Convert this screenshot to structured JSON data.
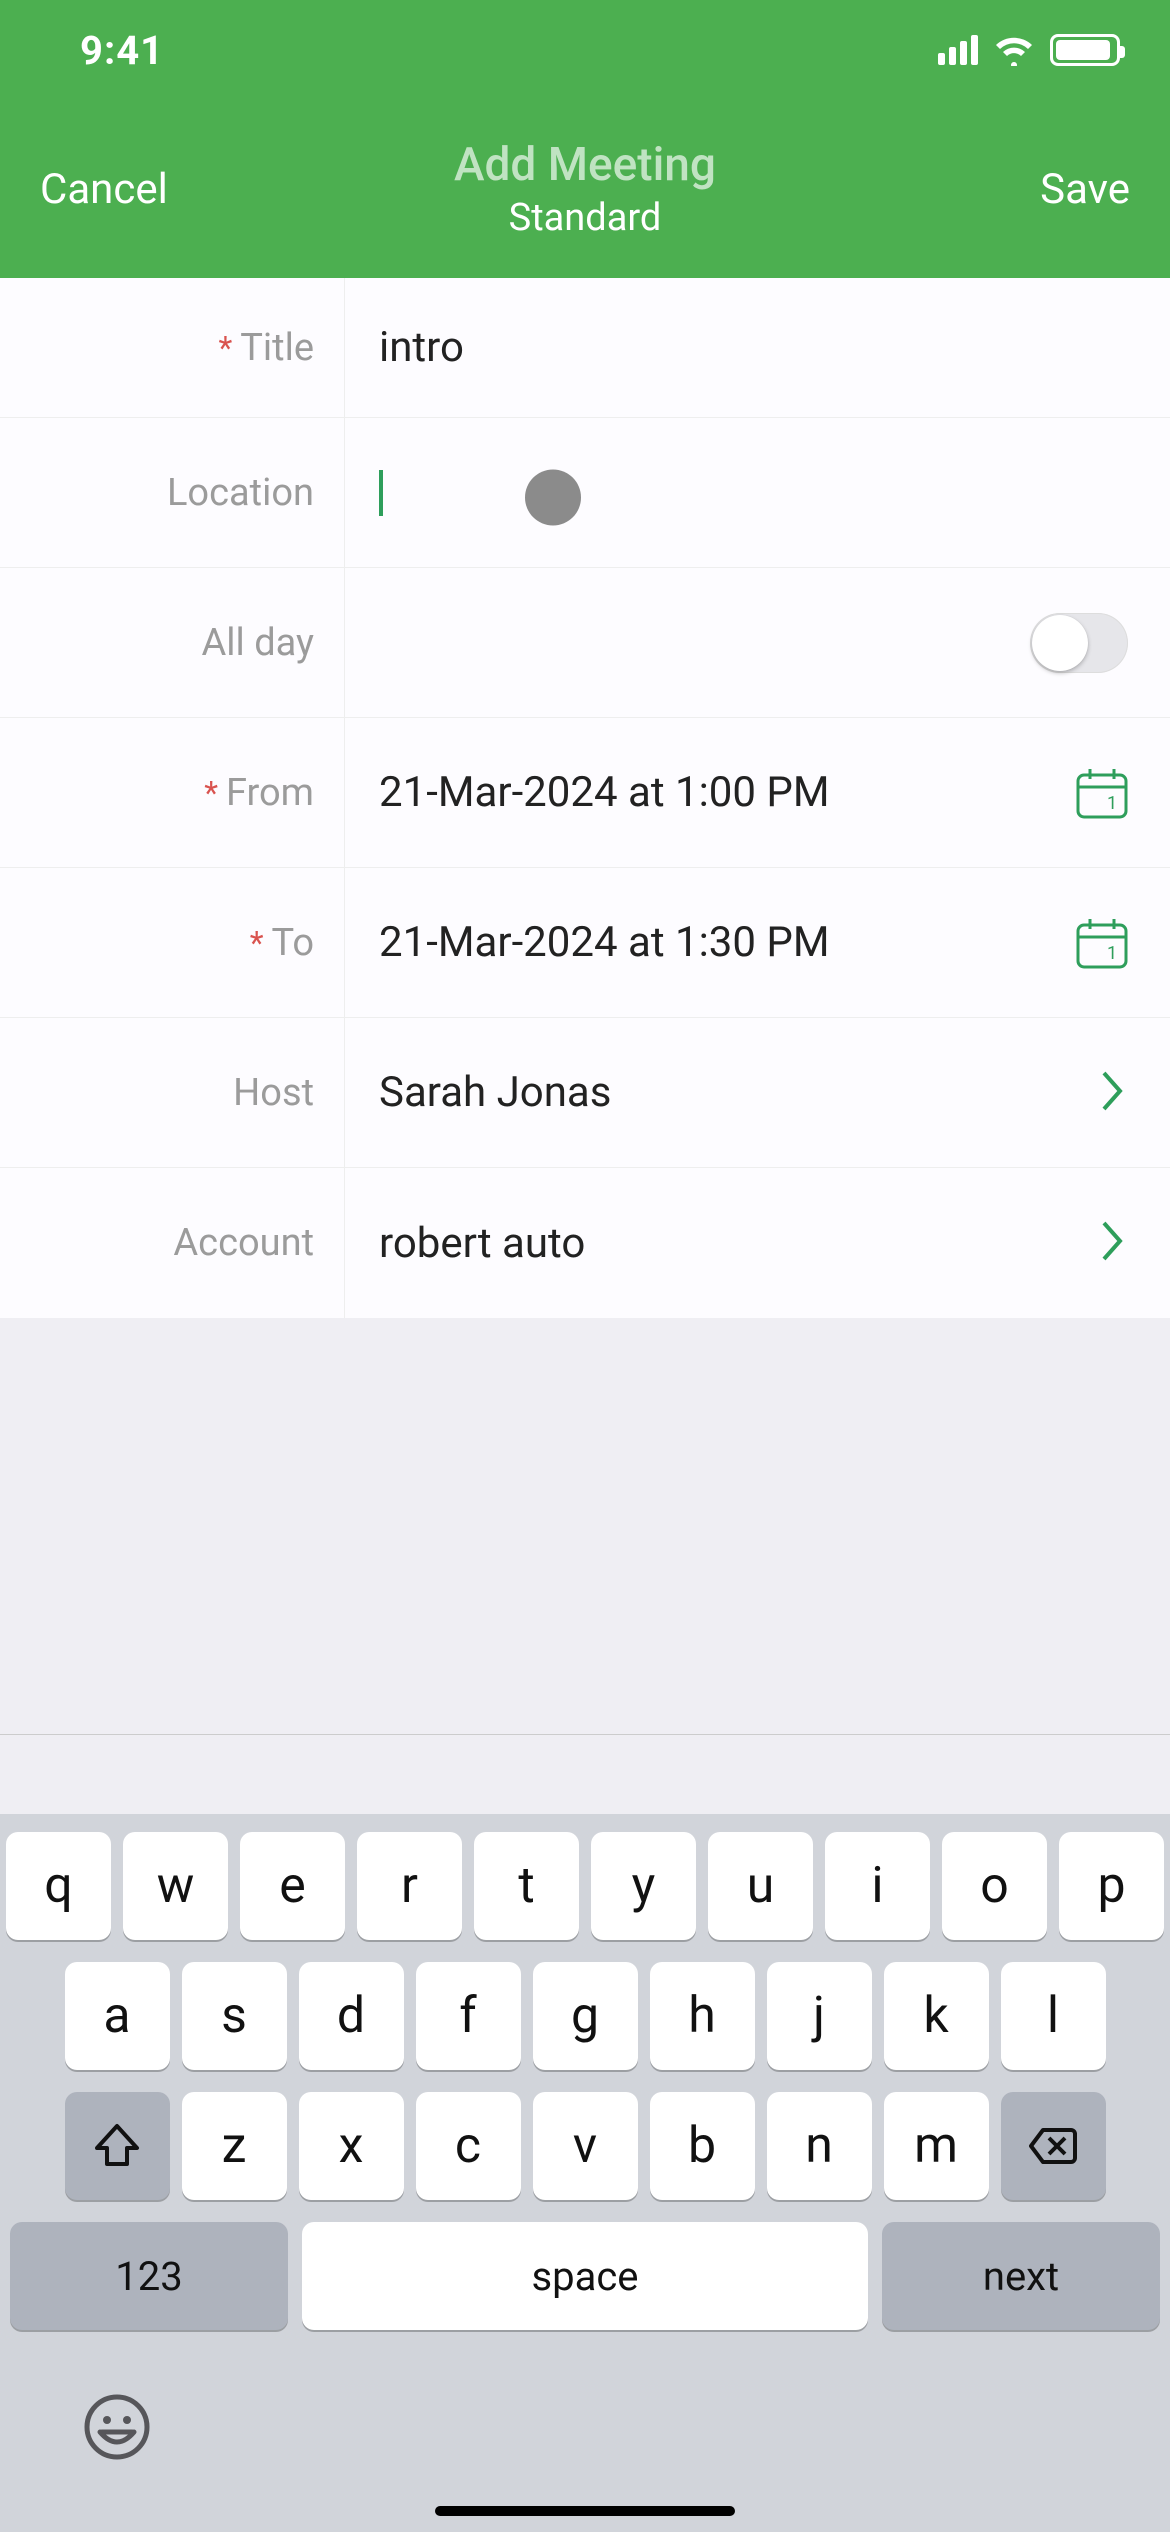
{
  "status": {
    "time": "9:41"
  },
  "nav": {
    "cancel": "Cancel",
    "title": "Add Meeting",
    "subtitle": "Standard",
    "save": "Save"
  },
  "fields": {
    "title_label": "Title",
    "title_value": "intro",
    "location_label": "Location",
    "location_value": "",
    "allday_label": "All day",
    "allday_on": false,
    "from_label": "From",
    "from_value": "21-Mar-2024 at 1:00 PM",
    "to_label": "To",
    "to_value": "21-Mar-2024 at 1:30 PM",
    "host_label": "Host",
    "host_value": "Sarah Jonas",
    "account_label": "Account",
    "account_value": "robert auto"
  },
  "keyboard": {
    "row1": [
      "q",
      "w",
      "e",
      "r",
      "t",
      "y",
      "u",
      "i",
      "o",
      "p"
    ],
    "row2": [
      "a",
      "s",
      "d",
      "f",
      "g",
      "h",
      "j",
      "k",
      "l"
    ],
    "row3": [
      "z",
      "x",
      "c",
      "v",
      "b",
      "n",
      "m"
    ],
    "num_key": "123",
    "space_key": "space",
    "action_key": "next"
  }
}
